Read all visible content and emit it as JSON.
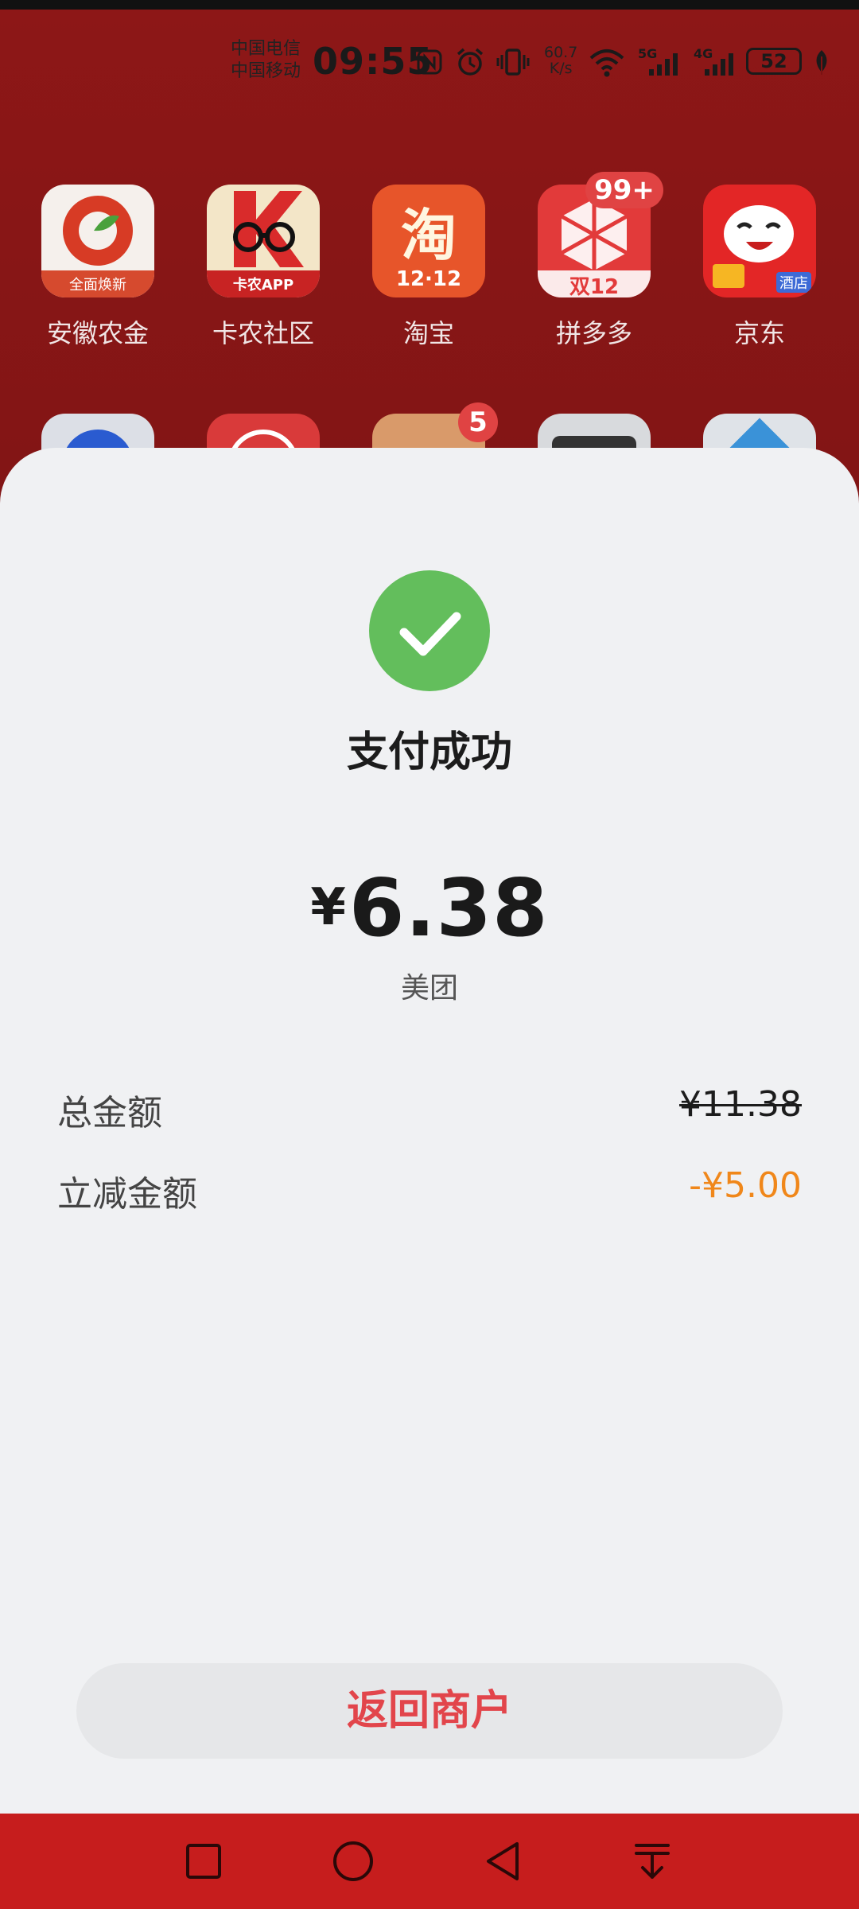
{
  "status_bar": {
    "carrier_1": "中国电信",
    "carrier_2": "中国移动",
    "time": "09:55",
    "speed_value": "60.7",
    "speed_unit": "K/s",
    "signal_1_label": "5G",
    "signal_2_label": "4G",
    "battery_level": "52",
    "icons": [
      "nfc-icon",
      "alarm-icon",
      "vibrate-icon",
      "wifi-icon",
      "signal-5g-icon",
      "signal-4g-icon",
      "battery-icon",
      "leaf-icon"
    ]
  },
  "home_apps": [
    {
      "label": "安徽农金",
      "tile_text": "全面焕新",
      "icon": "anhui-rural-bank-icon"
    },
    {
      "label": "卡农社区",
      "tile_text": "卡农APP",
      "icon": "kanong-icon"
    },
    {
      "label": "淘宝",
      "tile_text": "12·12",
      "icon": "taobao-icon"
    },
    {
      "label": "拼多多",
      "tile_text": "双12",
      "badge": "99+",
      "icon": "pinduoduo-icon"
    },
    {
      "label": "京东",
      "tile_text": "酒店",
      "icon": "jd-icon"
    }
  ],
  "second_row_badge": "5",
  "payment": {
    "title": "支付成功",
    "currency": "¥",
    "amount": "6.38",
    "merchant": "美团",
    "total_label": "总金额",
    "total_value": "¥11.38",
    "discount_label": "立减金额",
    "discount_value": "-¥5.00",
    "return_button": "返回商户"
  },
  "colors": {
    "success_green": "#63be5c",
    "discount_orange": "#f0871a",
    "button_text_red": "#e2454b",
    "navbar_red": "#c61d1d"
  },
  "navigation": {
    "icons": [
      "recent-apps-icon",
      "home-icon",
      "back-icon",
      "notification-pull-icon"
    ]
  }
}
